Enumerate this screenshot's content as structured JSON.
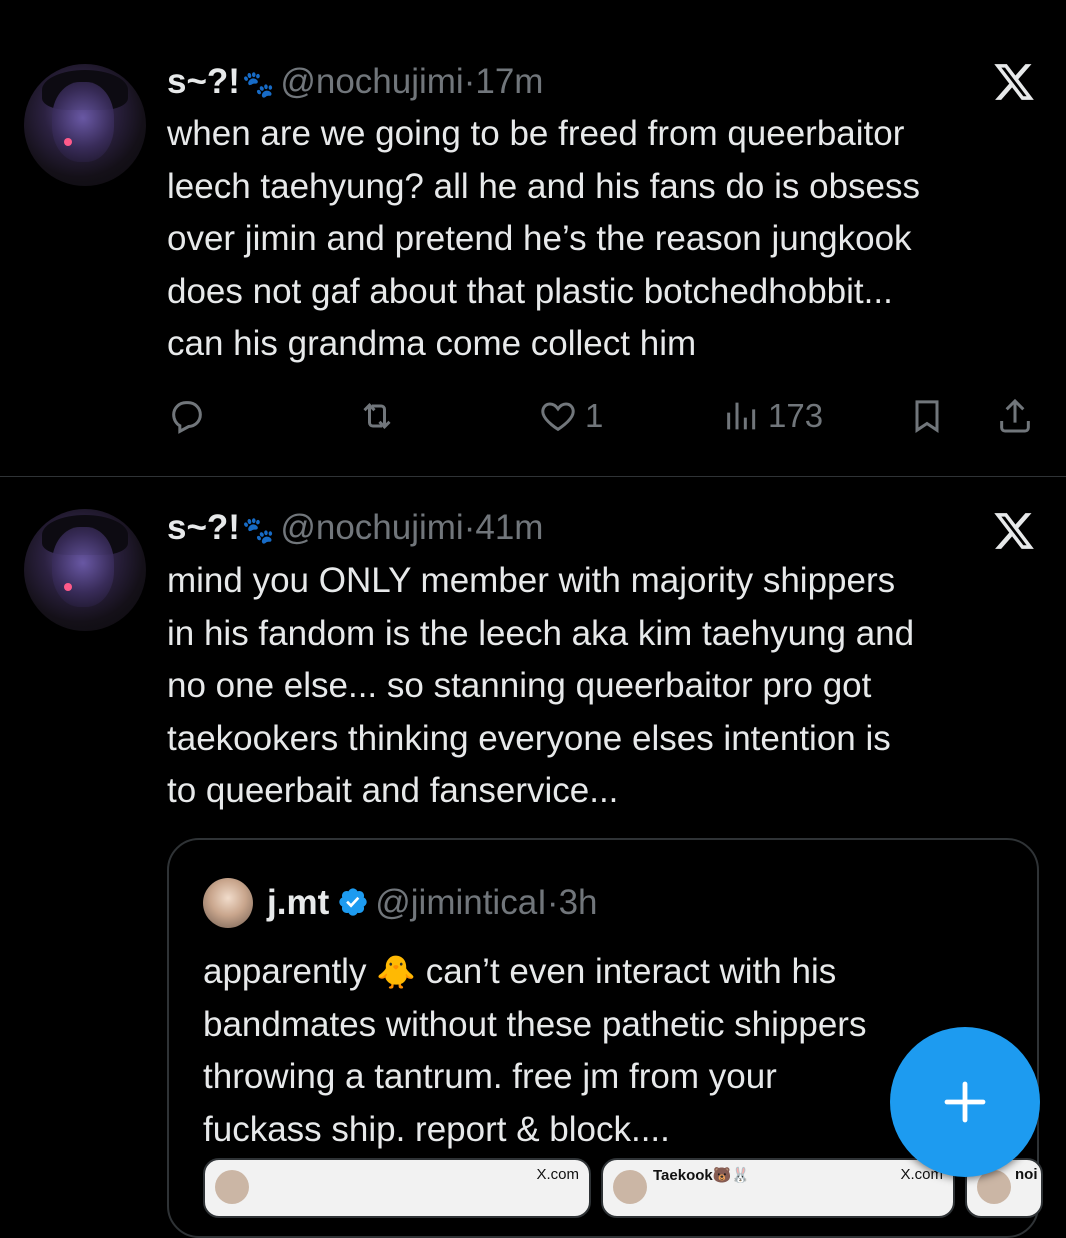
{
  "tweets": [
    {
      "author_name": "s~?!",
      "paw_icon": "🐾",
      "handle": "@nochujimi",
      "separator": "·",
      "time": "17m",
      "text": "when are we going to be freed from queerbaitor\nleech taehyung? all he and his fans do is obsess\nover jimin and pretend he’s the reason jungkook\ndoes not gaf about that plastic botchedhobbit...\ncan his grandma come collect him",
      "likes": "1",
      "views": "173"
    },
    {
      "author_name": "s~?!",
      "paw_icon": "🐾",
      "handle": "@nochujimi",
      "separator": "·",
      "time": "41m",
      "text": "mind you ONLY member with majority shippers\nin his fandom is the leech aka kim taehyung and\nno one else... so stanning queerbaitor pro got\ntaekookers thinking everyone elses intention is\nto queerbait and fanservice...",
      "quote": {
        "author_name": "j.mt",
        "handle": "@jiminticaI",
        "separator": "·",
        "time": "3h",
        "text_before_emoji": "apparently ",
        "emoji": "🐥",
        "text_after_emoji": " can’t even interact with his\nbandmates without these pathetic shippers\nthrowing a tantrum. free jm from your\nfuckass ship. report & block....",
        "cards": [
          {
            "source": "X.com"
          },
          {
            "title": "Taekook🐻🐰",
            "source": "X.com"
          },
          {
            "title": "noi"
          }
        ]
      }
    }
  ],
  "colors": {
    "background": "#000000",
    "text": "#e7e9ea",
    "muted": "#71767b",
    "divider": "#2f3336",
    "accent": "#1d9bf0"
  },
  "icons": {
    "platform_logo": "x-logo-icon",
    "reply": "reply-icon",
    "retweet": "retweet-icon",
    "like": "heart-icon",
    "views": "views-icon",
    "bookmark": "bookmark-icon",
    "share": "share-icon",
    "compose": "plus-icon",
    "verified": "verified-badge-icon"
  }
}
